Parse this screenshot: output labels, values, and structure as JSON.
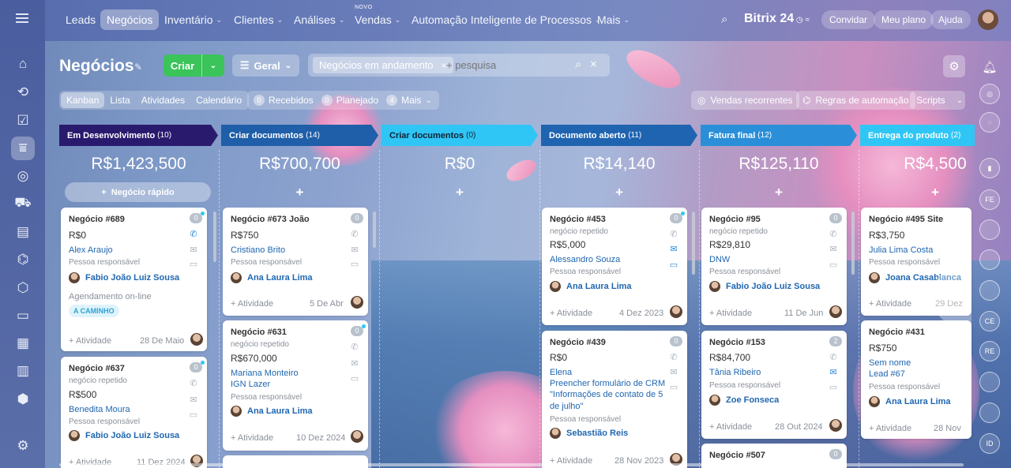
{
  "topnav": {
    "items": [
      {
        "label": "Leads",
        "chev": ""
      },
      {
        "label": "Negócios",
        "chev": ""
      },
      {
        "label": "Inventário",
        "chev": "⌄"
      },
      {
        "label": "Clientes",
        "chev": "⌄"
      },
      {
        "label": "Análises",
        "chev": "⌄"
      },
      {
        "label": "Vendas",
        "chev": "⌄"
      },
      {
        "label": "Automação Inteligente de Processos",
        "chev": "⌄"
      },
      {
        "label": "Mais",
        "chev": "⌄"
      }
    ],
    "novo_label": "NOVO",
    "brand": "Bitrix",
    "brand_num": "24",
    "invite": "Convidar",
    "plan": "Meu plano",
    "help": "Ajuda"
  },
  "page": {
    "title": "Negócios",
    "create": "Criar",
    "general": "Geral",
    "filter_chip": "Negócios em andamento",
    "search_placeholder": "+ pesquisa"
  },
  "views": [
    "Kanban",
    "Lista",
    "Atividades",
    "Calendário"
  ],
  "counters": [
    {
      "n": "0",
      "label": "Recebidos"
    },
    {
      "n": "0",
      "label": "Planejado"
    },
    {
      "n": "4",
      "label": "Mais"
    }
  ],
  "toolbar": {
    "recurring": "Vendas recorrentes",
    "automation": "Regras de automação",
    "scripts": "Scripts"
  },
  "colors": {
    "stage1": "#2a1a6e",
    "stage2": "#1f5ea8",
    "stage3": "#2fc6f6",
    "stage4": "#1f64b0",
    "stage5": "#2a8fd8",
    "stage6": "#2fc6f6",
    "create": "#3bc459",
    "link": "#2067b0"
  },
  "stages": [
    {
      "name": "Em Desenvolvimento",
      "count": "(10)",
      "sum": "R$1,423,500"
    },
    {
      "name": "Criar documentos",
      "count": "(14)",
      "sum": "R$700,700"
    },
    {
      "name": "Criar documentos",
      "count": "(0)",
      "sum": "R$0"
    },
    {
      "name": "Documento aberto",
      "count": "(11)",
      "sum": "R$14,140"
    },
    {
      "name": "Fatura final",
      "count": "(12)",
      "sum": "R$125,110"
    },
    {
      "name": "Entrega do produto",
      "count": "(2)",
      "sum": "R$4,500"
    }
  ],
  "quick_deal": "Negócio rápido",
  "plus": "+",
  "labels": {
    "responsible": "Pessoa responsável",
    "activity": "+ Atividade",
    "repeat": "negócio repetido",
    "booking": "Agendamento on-line",
    "on_way": "A CAMINHO"
  },
  "cards": {
    "c689": {
      "title": "Negócio #689",
      "badge": "0",
      "amount": "R$0",
      "contact": "Alex Araujo",
      "person": "Fabio João Luiz Sousa",
      "date": "28 De Maio"
    },
    "c637": {
      "title": "Negócio #637",
      "badge": "0",
      "amount": "R$500",
      "contact": "Benedita Moura",
      "person": "Fabio João Luiz Sousa",
      "date": "11 Dez 2024"
    },
    "c673": {
      "title": "Negócio #673 João",
      "badge": "0",
      "amount": "R$750",
      "contact": "Cristiano Brito",
      "person": "Ana Laura Lima",
      "date": "5 De Abr"
    },
    "c631": {
      "title": "Negócio #631",
      "badge": "0",
      "amount": "R$670,000",
      "contact": "Mariana Monteiro",
      "contact2": "IGN Lazer",
      "person": "Ana Laura Lima",
      "date": "10 Dez 2024"
    },
    "c453": {
      "title": "Negócio #453",
      "badge": "0",
      "amount": "R$5,000",
      "contact": "Alessandro Souza",
      "person": "Ana Laura Lima",
      "date": "4 Dez 2023"
    },
    "c439": {
      "title": "Negócio #439",
      "badge": "0",
      "amount": "R$0",
      "contact": "Elena",
      "form1": "Preencher formulário de CRM",
      "form2": "\"Informações de contato de 5",
      "form3": "de julho\"",
      "person": "Sebastião Reis",
      "date": "28 Nov 2023"
    },
    "c95": {
      "title": "Negócio #95",
      "badge": "0",
      "amount": "R$29,810",
      "contact": "DNW",
      "person": "Fabio João Luiz Sousa",
      "date": "11 De Jun"
    },
    "c153": {
      "title": "Negócio #153",
      "badge": "2",
      "amount": "R$84,700",
      "contact": "Tânia Ribeiro",
      "person": "Zoe Fonseca",
      "date": "28 Out 2024"
    },
    "c507": {
      "title": "Negócio #507",
      "badge": "0"
    },
    "c495": {
      "title": "Negócio #495 Site",
      "amount": "R$3,750",
      "contact": "Julia Lima Costa",
      "person": "Joana Casablanca",
      "date": "29 Dez"
    },
    "c431": {
      "title": "Negócio #431",
      "amount": "R$750",
      "contact": "Sem nome",
      "contact2": "Lead #67",
      "person": "Ana Laura Lima",
      "date": "28 Nov"
    }
  },
  "right_rail": [
    "FE",
    "CE",
    "RE",
    "ID"
  ]
}
